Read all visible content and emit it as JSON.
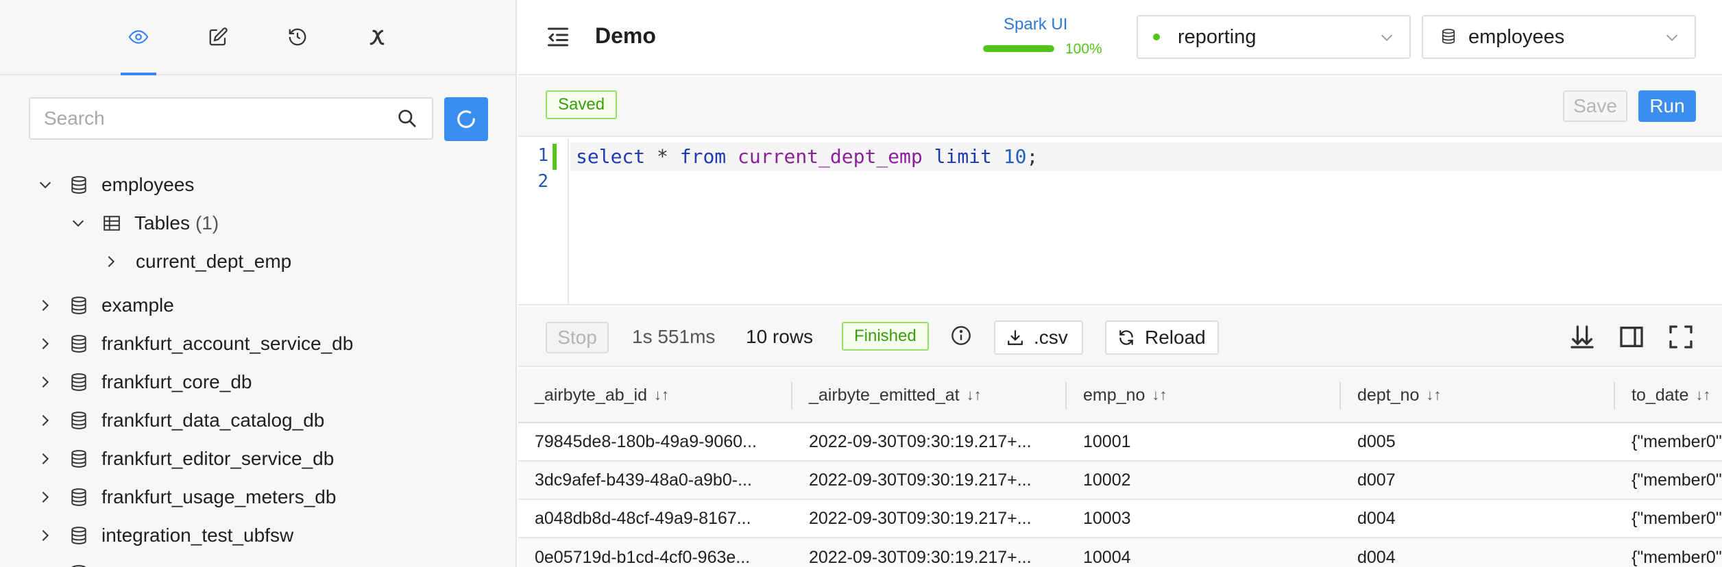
{
  "sidebar": {
    "tabs": [
      {
        "name": "eye-icon"
      },
      {
        "name": "edit-icon"
      },
      {
        "name": "history-icon"
      },
      {
        "name": "variable-icon"
      }
    ],
    "search_placeholder": "Search",
    "tree": [
      {
        "label": "employees",
        "expanded": true
      },
      {
        "label": "Tables",
        "count": "(1)",
        "expanded": true
      },
      {
        "label": "current_dept_emp"
      },
      {
        "label": "example"
      },
      {
        "label": "frankfurt_account_service_db"
      },
      {
        "label": "frankfurt_core_db"
      },
      {
        "label": "frankfurt_data_catalog_db"
      },
      {
        "label": "frankfurt_editor_service_db"
      },
      {
        "label": "frankfurt_usage_meters_db"
      },
      {
        "label": "integration_test_ubfsw"
      }
    ]
  },
  "header": {
    "title": "Demo",
    "spark_ui_label": "Spark UI",
    "spark_progress": 1.0,
    "spark_progress_text": "100%",
    "cluster": "reporting",
    "database": "employees"
  },
  "toolbar": {
    "saved_label": "Saved",
    "save_label": "Save",
    "run_label": "Run"
  },
  "editor": {
    "line_numbers": [
      "1",
      "2"
    ],
    "tokens": [
      {
        "t": "select",
        "c": "kw"
      },
      {
        "t": " * ",
        "c": "op"
      },
      {
        "t": "from",
        "c": "kw"
      },
      {
        "t": " ",
        "c": "op"
      },
      {
        "t": "current_dept_emp",
        "c": "ident"
      },
      {
        "t": " ",
        "c": "op"
      },
      {
        "t": "limit",
        "c": "kw"
      },
      {
        "t": " ",
        "c": "op"
      },
      {
        "t": "10",
        "c": "num"
      },
      {
        "t": ";",
        "c": "punc"
      }
    ]
  },
  "results": {
    "stop_label": "Stop",
    "duration": "1s 551ms",
    "rows": "10 rows",
    "status": "Finished",
    "csv_label": ".csv",
    "reload_label": "Reload",
    "sort_glyph": "↓↑",
    "columns": [
      "_airbyte_ab_id",
      "_airbyte_emitted_at",
      "emp_no",
      "dept_no",
      "to_date"
    ],
    "rows_data": [
      [
        "79845de8-180b-49a9-9060...",
        "2022-09-30T09:30:19.217+...",
        "10001",
        "d005",
        "{\"member0\""
      ],
      [
        "3dc9afef-b439-48a0-a9b0-...",
        "2022-09-30T09:30:19.217+...",
        "10002",
        "d007",
        "{\"member0\""
      ],
      [
        "a048db8d-48cf-49a9-8167...",
        "2022-09-30T09:30:19.217+...",
        "10003",
        "d004",
        "{\"member0\""
      ],
      [
        "0e05719d-b1cd-4cf0-963e...",
        "2022-09-30T09:30:19.217+...",
        "10004",
        "d004",
        "{\"member0\""
      ]
    ]
  },
  "colors": {
    "accent": "#3b8ef0",
    "success": "#52c41a"
  }
}
